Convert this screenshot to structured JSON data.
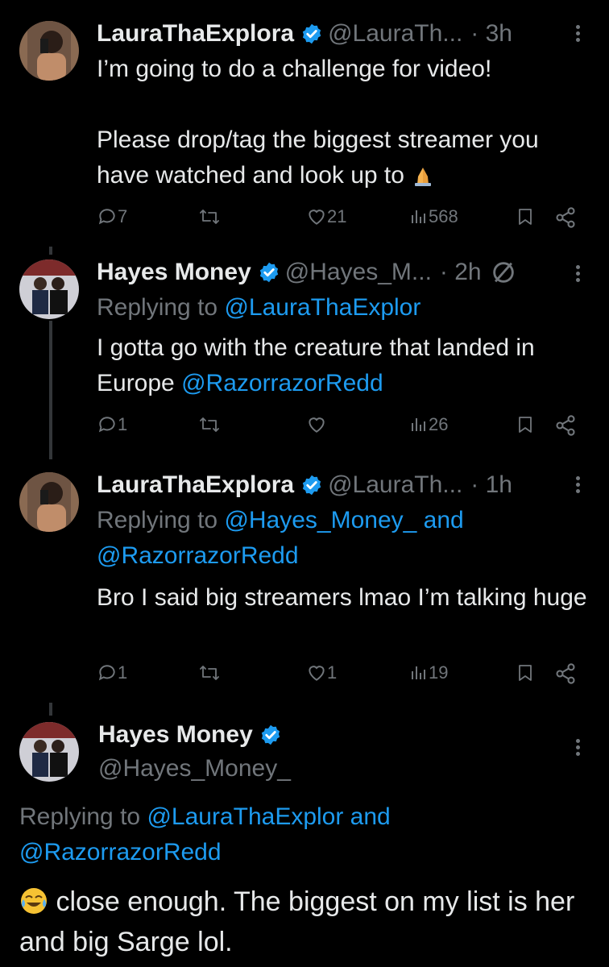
{
  "tweets": [
    {
      "name": "LauraThaExplora",
      "handle": "@LauraTh...",
      "time": "· 3h",
      "text": "I’m going to do a challenge for video!\n\nPlease drop/tag the biggest streamer you have watched and look up to",
      "text_emoji": "folded-hands",
      "replies": "7",
      "retweets": "",
      "likes": "21",
      "views": "568"
    },
    {
      "name": "Hayes Money",
      "handle": "@Hayes_M...",
      "time": "· 2h",
      "replying_label": "Replying to",
      "replying_to": "@LauraThaExplor",
      "text_prefix": "I gotta go with the creature that landed in Europe ",
      "mention": "@RazorrazorRedd",
      "replies": "1",
      "retweets": "",
      "likes": "",
      "views": "26"
    },
    {
      "name": "LauraThaExplora",
      "handle": "@LauraTh...",
      "time": "· 1h",
      "replying_label": "Replying to",
      "replying_to_line1": "@Hayes_Money_ and",
      "replying_to_line2": "@RazorrazorRedd",
      "text": "Bro I said big streamers lmao I’m talking huge",
      "replies": "1",
      "retweets": "",
      "likes": "1",
      "views": "19"
    },
    {
      "name": "Hayes Money",
      "handle": "@Hayes_Money_",
      "replying_label": "Replying to",
      "replying_to_line1": "@LauraThaExplor and",
      "replying_to_line2": "@RazorrazorRedd",
      "text_emoji": "face-with-tears-of-joy",
      "text": " close enough. The biggest on my list is her and big Sarge lol."
    }
  ],
  "colors": {
    "accent": "#1d9bf0",
    "muted": "#71767b",
    "text": "#e7e9ea",
    "background": "#000000"
  }
}
